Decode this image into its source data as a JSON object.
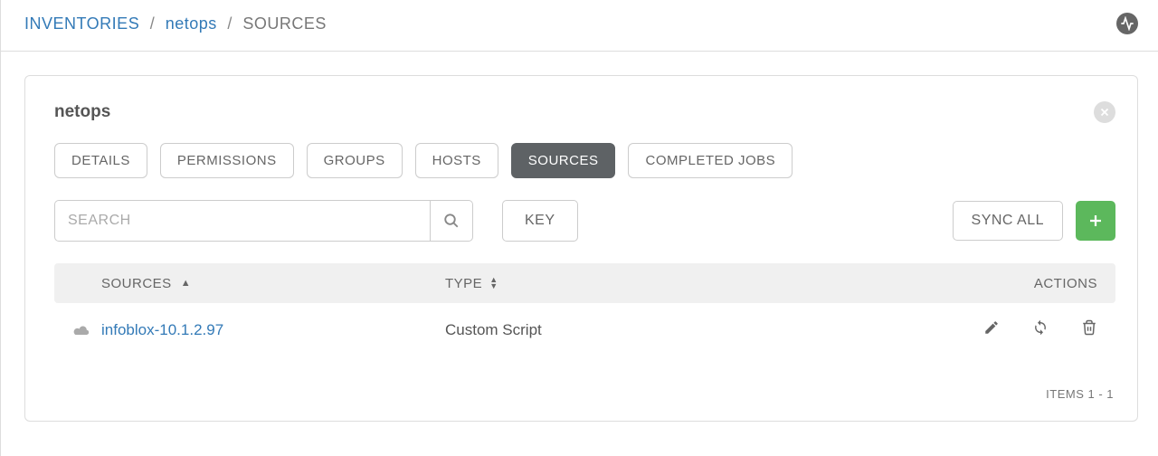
{
  "breadcrumb": {
    "root": "INVENTORIES",
    "parent": "netops",
    "current": "SOURCES"
  },
  "card": {
    "title": "netops"
  },
  "tabs": [
    {
      "label": "DETAILS",
      "active": false
    },
    {
      "label": "PERMISSIONS",
      "active": false
    },
    {
      "label": "GROUPS",
      "active": false
    },
    {
      "label": "HOSTS",
      "active": false
    },
    {
      "label": "SOURCES",
      "active": true
    },
    {
      "label": "COMPLETED JOBS",
      "active": false
    }
  ],
  "search": {
    "placeholder": "SEARCH"
  },
  "buttons": {
    "key": "KEY",
    "sync_all": "SYNC ALL"
  },
  "table": {
    "headers": {
      "sources": "SOURCES",
      "type": "TYPE",
      "actions": "ACTIONS"
    },
    "rows": [
      {
        "name": "infoblox-10.1.2.97",
        "type": "Custom Script"
      }
    ]
  },
  "pagination": {
    "label": "ITEMS  1 - 1"
  }
}
